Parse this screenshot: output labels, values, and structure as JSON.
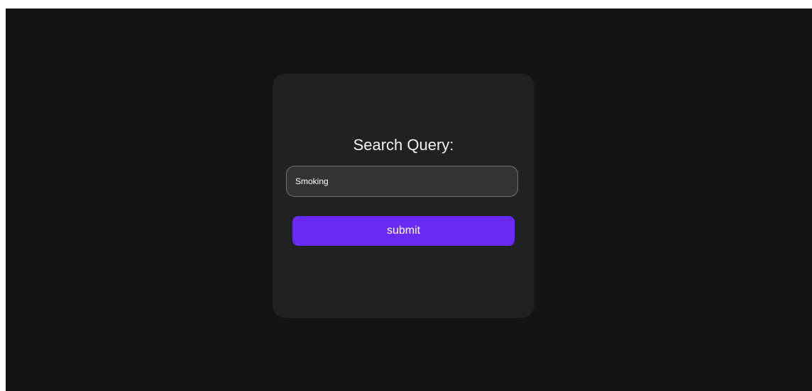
{
  "form": {
    "title": "Search Query:",
    "search_value": "Smoking",
    "submit_label": "submit"
  },
  "colors": {
    "page_background": "#131313",
    "card_background": "#212121",
    "input_background": "#333333",
    "accent": "#6a2af5"
  }
}
